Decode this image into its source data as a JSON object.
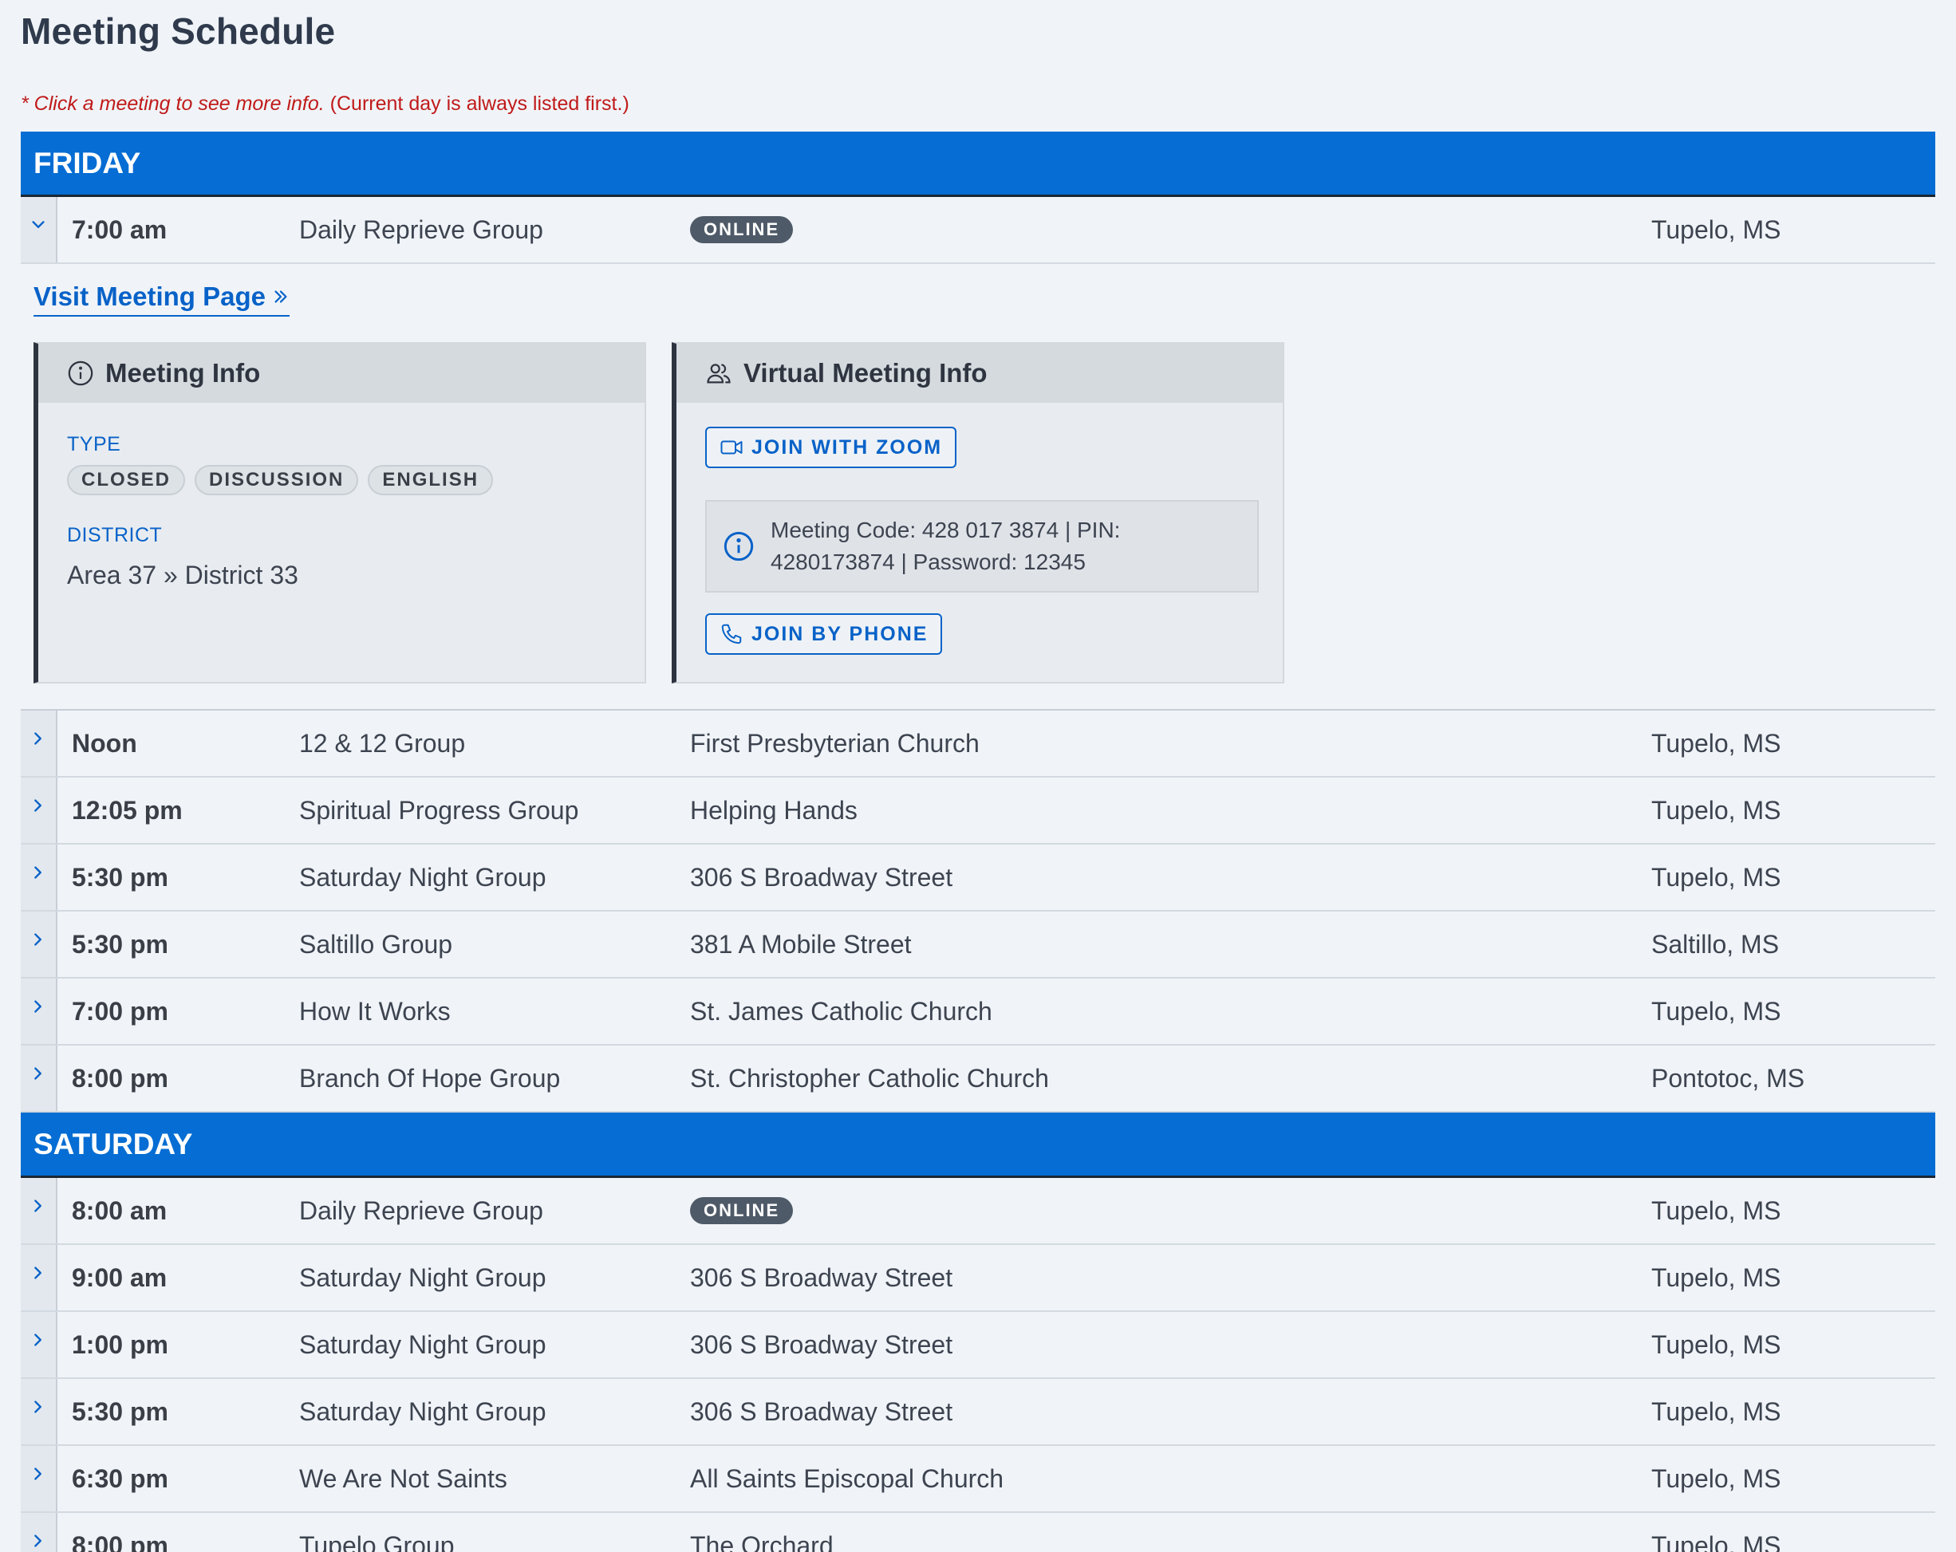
{
  "page": {
    "title": "Meeting Schedule",
    "hint_italic": "* Click a meeting to see more info.",
    "hint_rest": " (Current day is always listed first.)"
  },
  "days": [
    {
      "name": "FRIDAY",
      "meetings": [
        {
          "time": "7:00 am",
          "name": "Daily Reprieve Group",
          "location": "",
          "badge": "ONLINE",
          "region": "Tupelo, MS",
          "expanded": true
        },
        {
          "time": "Noon",
          "name": "12 & 12 Group",
          "location": "First Presbyterian Church",
          "badge": "",
          "region": "Tupelo, MS"
        },
        {
          "time": "12:05 pm",
          "name": "Spiritual Progress Group",
          "location": "Helping Hands",
          "badge": "",
          "region": "Tupelo, MS"
        },
        {
          "time": "5:30 pm",
          "name": "Saturday Night Group",
          "location": "306 S Broadway Street",
          "badge": "",
          "region": "Tupelo, MS"
        },
        {
          "time": "5:30 pm",
          "name": "Saltillo Group",
          "location": "381 A Mobile Street",
          "badge": "",
          "region": "Saltillo, MS"
        },
        {
          "time": "7:00 pm",
          "name": "How It Works",
          "location": "St. James Catholic Church",
          "badge": "",
          "region": "Tupelo, MS"
        },
        {
          "time": "8:00 pm",
          "name": "Branch Of Hope Group",
          "location": "St. Christopher Catholic Church",
          "badge": "",
          "region": "Pontotoc, MS"
        }
      ]
    },
    {
      "name": "SATURDAY",
      "meetings": [
        {
          "time": "8:00 am",
          "name": "Daily Reprieve Group",
          "location": "",
          "badge": "ONLINE",
          "region": "Tupelo, MS"
        },
        {
          "time": "9:00 am",
          "name": "Saturday Night Group",
          "location": "306 S Broadway Street",
          "badge": "",
          "region": "Tupelo, MS"
        },
        {
          "time": "1:00 pm",
          "name": "Saturday Night Group",
          "location": "306 S Broadway Street",
          "badge": "",
          "region": "Tupelo, MS"
        },
        {
          "time": "5:30 pm",
          "name": "Saturday Night Group",
          "location": "306 S Broadway Street",
          "badge": "",
          "region": "Tupelo, MS"
        },
        {
          "time": "6:30 pm",
          "name": "We Are Not Saints",
          "location": "All Saints Episcopal Church",
          "badge": "",
          "region": "Tupelo, MS"
        },
        {
          "time": "8:00 pm",
          "name": "Tupelo Group",
          "location": "The Orchard",
          "badge": "",
          "region": "Tupelo, MS"
        }
      ]
    }
  ],
  "detail": {
    "visit_link": "Visit Meeting Page",
    "meeting_info": {
      "title": "Meeting Info",
      "type_label": "TYPE",
      "types": [
        "CLOSED",
        "DISCUSSION",
        "ENGLISH"
      ],
      "district_label": "DISTRICT",
      "district": "Area 37 » District 33"
    },
    "virtual_info": {
      "title": "Virtual Meeting Info",
      "zoom_button": "JOIN WITH ZOOM",
      "code_text": "Meeting Code: 428 017 3874 | PIN: 4280173874 | Password: 12345",
      "phone_button": "JOIN BY PHONE"
    }
  },
  "colors": {
    "day_header_bg": "#056dd3",
    "link_blue": "#0862c8",
    "hint_red": "#c01a1a",
    "online_badge": "#4f5a68",
    "page_bg": "#f0f4f8"
  },
  "icons": {
    "collapsed_toggle": "chevron-right-icon",
    "expanded_toggle": "chevron-down-icon",
    "visit_link": "double-chevron-right-icon",
    "meeting_info": "info-circle-icon",
    "virtual_info": "users-icon",
    "zoom": "video-icon",
    "code_box": "info-circle-icon",
    "phone": "phone-icon"
  }
}
